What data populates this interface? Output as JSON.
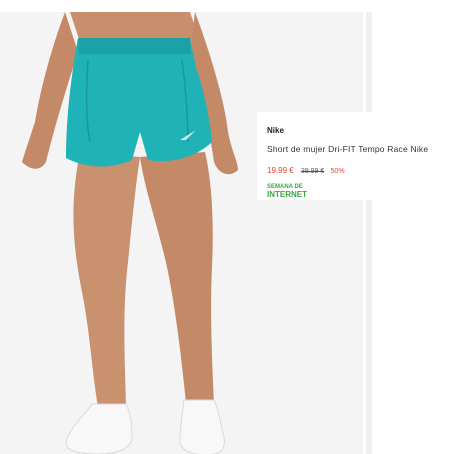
{
  "product": {
    "brand": "Nike",
    "title": "Short de mujer Dri-FIT Tempo Race Nike",
    "price_current": "19.99 €",
    "price_original": "39.99 €",
    "discount": "50%",
    "badge_line1": "SEMANA DE",
    "badge_line2": "INTERNET"
  },
  "colors": {
    "price": "#e2452f",
    "badge": "#3aa845",
    "shorts": "#1fb3b8"
  }
}
